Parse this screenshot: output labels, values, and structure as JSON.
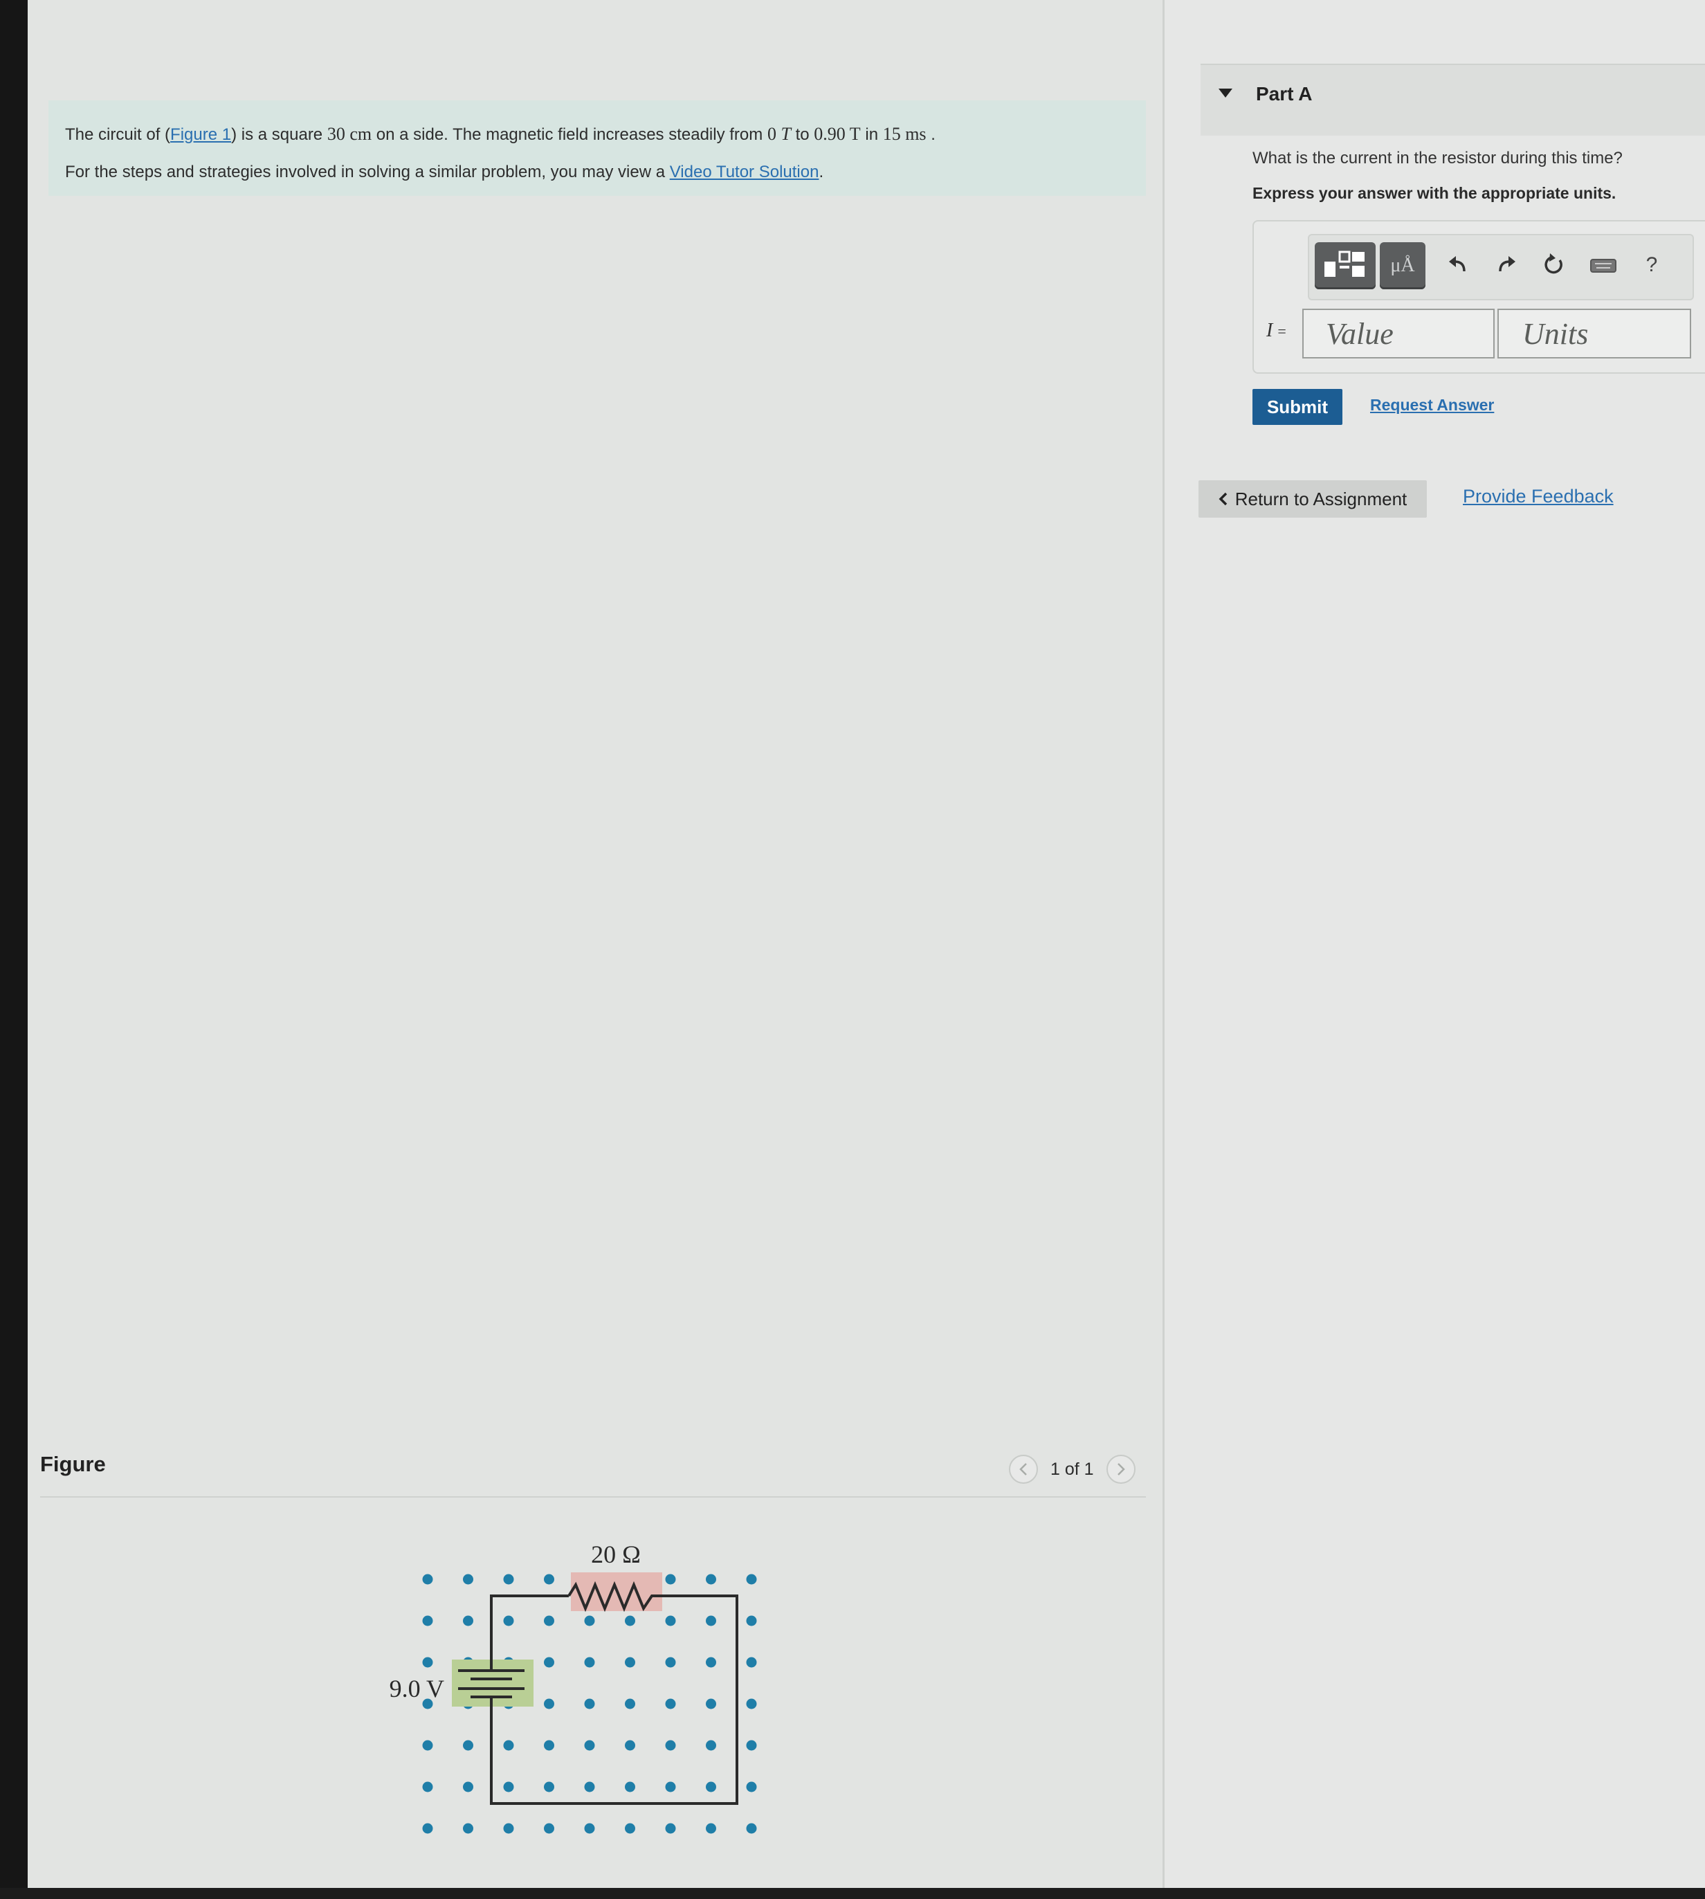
{
  "problem": {
    "line1_pre": "The circuit of (",
    "figure_link": "Figure 1",
    "line1_mid": ") is a square ",
    "side_value": "30",
    "side_unit": "cm",
    "line1_mid2": " on a side. The magnetic field increases steadily from ",
    "b_start": "0",
    "b_start_unit": "T",
    "line1_mid3": " to ",
    "b_end": "0.90",
    "b_end_unit": "T",
    "line1_mid4": " in ",
    "time_value": "15",
    "time_unit": "ms",
    "line1_end": " .",
    "line2_pre": "For the steps and strategies involved in solving a similar problem, you may view a ",
    "video_link": "Video Tutor Solution",
    "line2_end": "."
  },
  "figure": {
    "title": "Figure",
    "counter": "1 of 1",
    "prev_icon": "chevron-left-icon",
    "next_icon": "chevron-right-icon",
    "resistor_label": "20 Ω",
    "battery_label": "9.0 V",
    "dot_color": "#1f7ea8",
    "resistor_highlight": "#e4b9b4",
    "battery_highlight": "#b9cf95"
  },
  "part_a": {
    "title": "Part A",
    "question": "What is the current in the resistor during this time?",
    "instruction": "Express your answer with the appropriate units.",
    "toolbar": {
      "templates_icon": "templates-icon",
      "units_button": "μÅ",
      "undo_icon": "undo-icon",
      "redo_icon": "redo-icon",
      "reset_icon": "reset-icon",
      "keyboard_icon": "keyboard-icon",
      "help": "?"
    },
    "variable_symbol": "I",
    "variable_equals": "=",
    "value_placeholder": "Value",
    "units_placeholder": "Units",
    "submit": "Submit",
    "request_answer": "Request Answer"
  },
  "footer": {
    "return": "Return to Assignment",
    "feedback": "Provide Feedback"
  },
  "colors": {
    "problem_bg": "#d7e5e1",
    "link": "#2a6fb0",
    "submit_bg": "#1c5d93"
  }
}
